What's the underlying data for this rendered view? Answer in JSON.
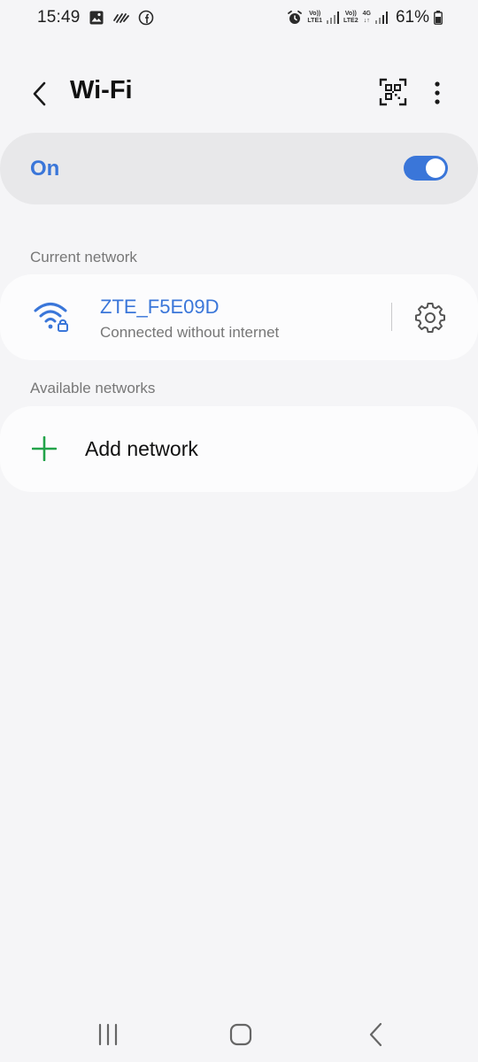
{
  "status_bar": {
    "time": "15:49",
    "left_icons": [
      "image-icon",
      "signal-wave-icon",
      "facebook-icon"
    ],
    "right_icons": [
      "alarm-icon",
      "lte1-signal-icon",
      "lte2-signal-icon",
      "4g-signal-icon",
      "battery-icon"
    ],
    "sim1_top": "Vo))",
    "sim1_bottom": "LTE1",
    "sim2_top": "Vo))",
    "sim2_bottom": "LTE2",
    "data_type": "4G",
    "battery": "61%"
  },
  "header": {
    "title": "Wi-Fi",
    "icons": [
      "back-arrow-icon",
      "qr-scan-icon",
      "more-options-icon"
    ]
  },
  "wifi_toggle": {
    "label": "On",
    "enabled": true
  },
  "current_network": {
    "section_label": "Current network",
    "name": "ZTE_F5E09D",
    "status": "Connected without internet",
    "icons": [
      "wifi-locked-icon",
      "gear-icon"
    ]
  },
  "available_networks": {
    "section_label": "Available networks",
    "add_label": "Add network",
    "icon": "plus-icon"
  },
  "colors": {
    "accent": "#3a76d9",
    "add_green": "#22a34a",
    "background": "#f5f5f7",
    "card": "#fcfcfd",
    "toggle_card": "#e8e8ea"
  },
  "nav_bar": {
    "icons": [
      "recents-icon",
      "home-icon",
      "back-icon"
    ]
  }
}
